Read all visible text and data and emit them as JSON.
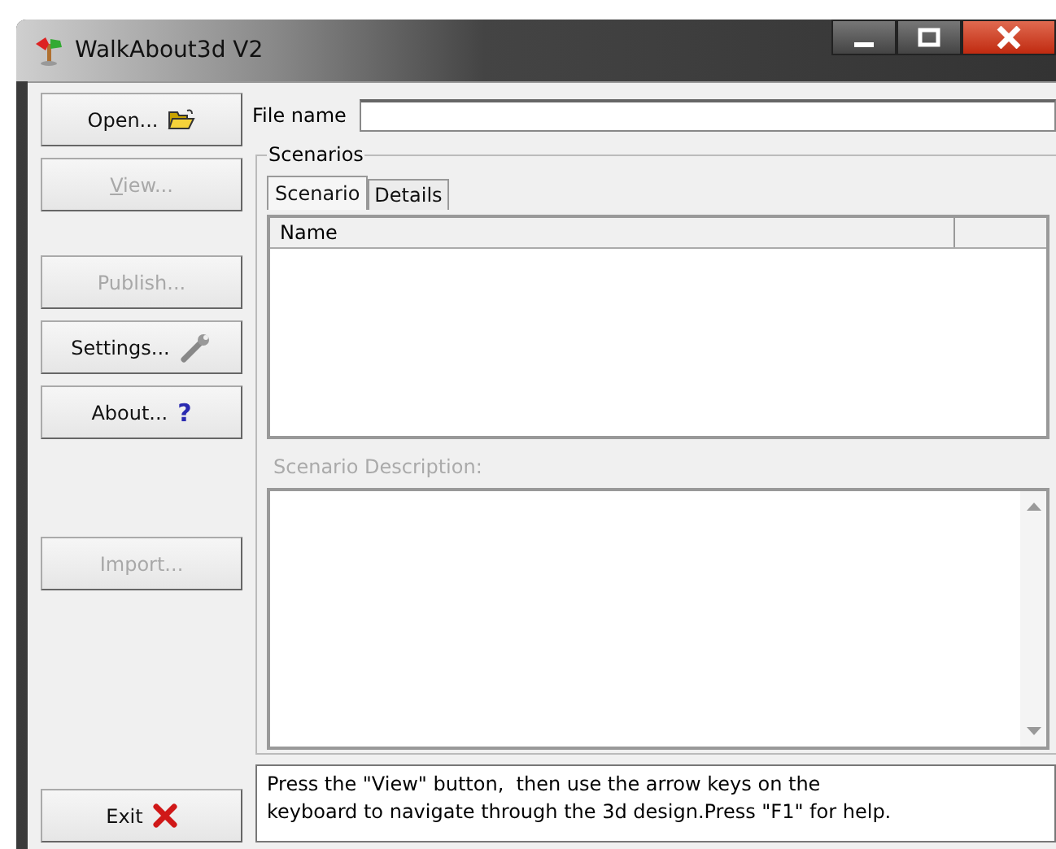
{
  "window": {
    "title": "WalkAbout3d V2"
  },
  "buttons": [
    {
      "label": "Open...",
      "disabled": false
    },
    {
      "label": "View...",
      "disabled": true
    },
    {
      "label": "Publish...",
      "disabled": true
    },
    {
      "label": "Settings...",
      "disabled": false
    },
    {
      "label": "About...",
      "disabled": false,
      "glyph": "?"
    },
    {
      "label": "Import...",
      "disabled": true
    },
    {
      "label": "Exit",
      "disabled": false
    }
  ],
  "file_name": {
    "label": "File name"
  },
  "scenarios": {
    "title": "Scenarios",
    "tabs": [
      {
        "label": "Scenario",
        "selected": true
      },
      {
        "label": "Details",
        "selected": false
      }
    ],
    "table": {
      "columns": [
        "Name"
      ]
    },
    "description_label": "Scenario Description:"
  },
  "status_text": "Press the \"View\" button,  then use the arrow keys on the keyboard to navigate through the 3d design.Press \"F1\" for help."
}
